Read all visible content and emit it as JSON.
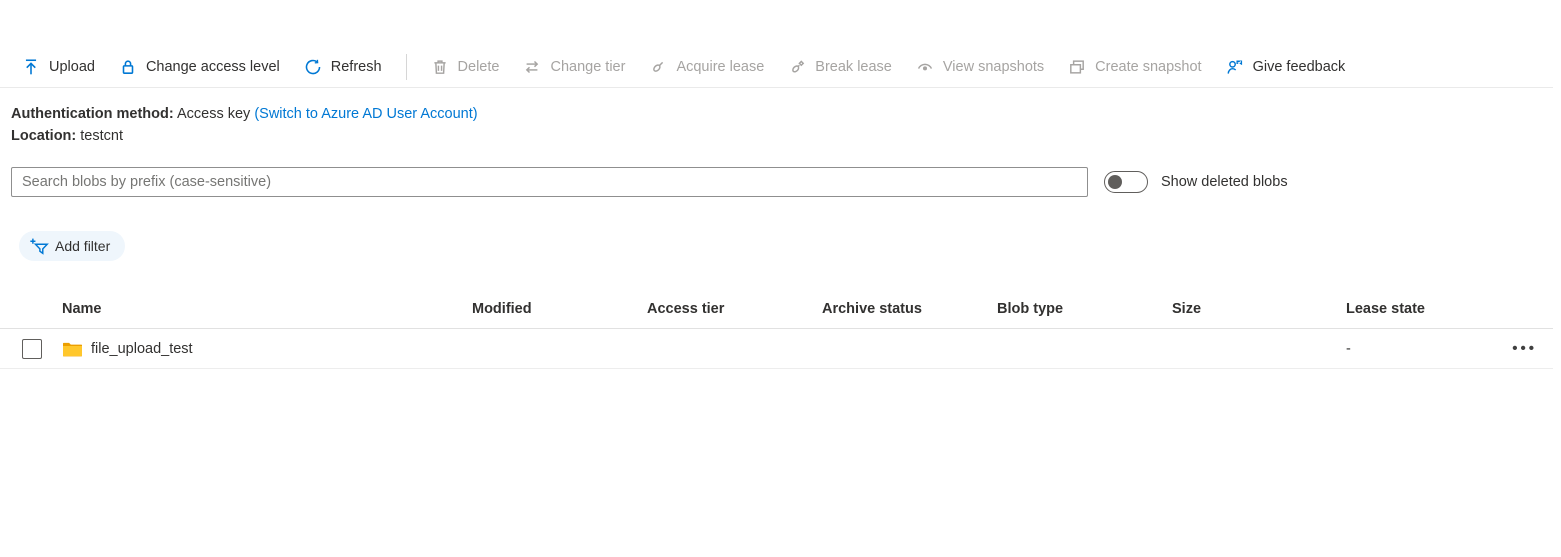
{
  "toolbar": {
    "items": [
      {
        "label": "Upload",
        "icon": "upload-icon",
        "enabled": true
      },
      {
        "label": "Change access level",
        "icon": "lock-icon",
        "enabled": true
      },
      {
        "label": "Refresh",
        "icon": "refresh-icon",
        "enabled": true
      },
      {
        "label": "Delete",
        "icon": "trash-icon",
        "enabled": false
      },
      {
        "label": "Change tier",
        "icon": "change-tier-icon",
        "enabled": false
      },
      {
        "label": "Acquire lease",
        "icon": "acquire-lease-icon",
        "enabled": false
      },
      {
        "label": "Break lease",
        "icon": "break-lease-icon",
        "enabled": false
      },
      {
        "label": "View snapshots",
        "icon": "eye-icon",
        "enabled": false
      },
      {
        "label": "Create snapshot",
        "icon": "snapshot-icon",
        "enabled": false
      },
      {
        "label": "Give feedback",
        "icon": "feedback-icon",
        "enabled": true
      }
    ]
  },
  "info": {
    "auth_label": "Authentication method:",
    "auth_value": "Access key",
    "auth_link": "(Switch to Azure AD User Account)",
    "location_label": "Location:",
    "location_value": "testcnt"
  },
  "search": {
    "placeholder": "Search blobs by prefix (case-sensitive)",
    "value": ""
  },
  "toggle": {
    "label": "Show deleted blobs",
    "state": "off"
  },
  "filter": {
    "add_filter_label": "Add filter"
  },
  "table": {
    "columns": [
      "Name",
      "Modified",
      "Access tier",
      "Archive status",
      "Blob type",
      "Size",
      "Lease state"
    ],
    "rows": [
      {
        "name": "file_upload_test",
        "kind": "folder",
        "lease_state": "-",
        "menu_icon": "ellipsis-icon"
      }
    ]
  },
  "colors": {
    "accent": "#0078d4",
    "disabled": "#a6a4a2",
    "folder_front": "#ffc72c",
    "folder_back": "#ec9f00"
  }
}
